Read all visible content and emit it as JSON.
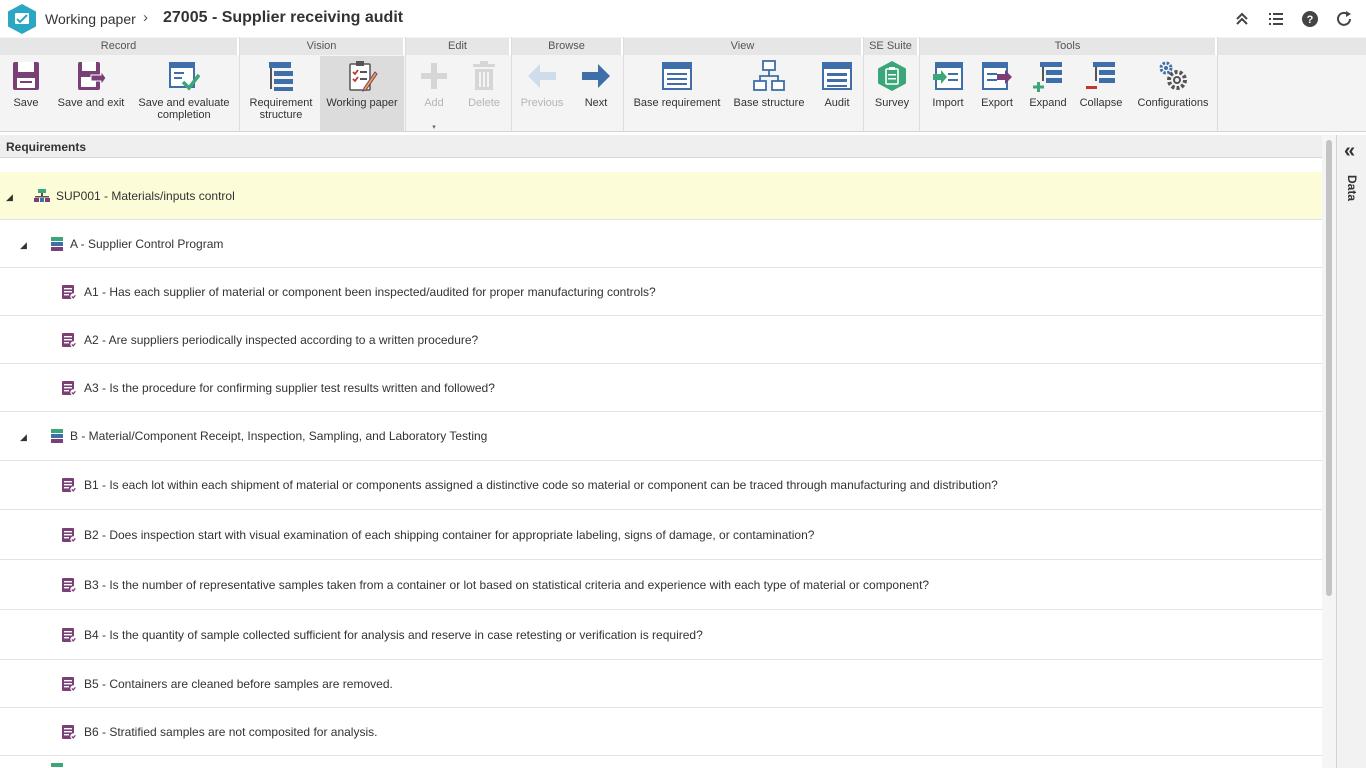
{
  "titlebar": {
    "app_name": "Working paper",
    "separator": "›",
    "title": "27005 - Supplier receiving audit",
    "icons": [
      "collapse-up-icon",
      "list-icon",
      "help-icon",
      "refresh-icon"
    ]
  },
  "ribbon": {
    "groups": {
      "record": "Record",
      "vision": "Vision",
      "edit": "Edit",
      "browse": "Browse",
      "view": "View",
      "se_suite": "SE Suite",
      "tools": "Tools"
    },
    "buttons": {
      "save": "Save",
      "save_exit": "Save and exit",
      "save_evaluate": "Save and evaluate completion",
      "req_structure": "Requirement structure",
      "working_paper": "Working paper",
      "add": "Add",
      "delete": "Delete",
      "previous": "Previous",
      "next": "Next",
      "base_requirement": "Base requirement",
      "base_structure": "Base structure",
      "audit": "Audit",
      "survey": "Survey",
      "import": "Import",
      "export": "Export",
      "expand": "Expand",
      "collapse": "Collapse",
      "configurations": "Configurations"
    },
    "caret": "▾"
  },
  "panel": {
    "header": "Requirements",
    "rows": [
      {
        "text": "SUP001 - Materials/inputs control",
        "kind": "root",
        "toggle": "◢"
      },
      {
        "text": "A - Supplier Control Program",
        "kind": "section",
        "toggle": "◢"
      },
      {
        "text": "A1 - Has each supplier of material or component been inspected/audited for proper manufacturing controls?",
        "kind": "item"
      },
      {
        "text": "A2 - Are suppliers periodically inspected according to a written procedure?",
        "kind": "item"
      },
      {
        "text": "A3 - Is the procedure for confirming supplier test results written and followed?",
        "kind": "item"
      },
      {
        "text": "B - Material/Component Receipt, Inspection, Sampling, and Laboratory Testing",
        "kind": "section",
        "toggle": "◢"
      },
      {
        "text": "B1 - Is each lot within each shipment of material or components assigned a distinctive code so material or component can be traced through manufacturing and distribution?",
        "kind": "item"
      },
      {
        "text": "B2 - Does inspection start with visual examination of each shipping container for appropriate labeling, signs of damage, or contamination?",
        "kind": "item"
      },
      {
        "text": "B3 - Is the number of representative samples taken from a container or lot based on statistical criteria and experience with each type of material or component?",
        "kind": "item"
      },
      {
        "text": "B4 - Is the quantity of sample collected sufficient for analysis and reserve in case retesting or verification is required?",
        "kind": "item"
      },
      {
        "text": "B5 - Containers are cleaned before samples are removed.",
        "kind": "item"
      },
      {
        "text": "B6 - Stratified samples are not composited for analysis.",
        "kind": "item"
      }
    ]
  },
  "side_panel": {
    "label": "Data",
    "collapse_glyph": "«"
  },
  "colors": {
    "accent_teal": "#2ba7c4",
    "purple": "#7b3f77",
    "blue": "#3e6fa8",
    "green": "#3aa67a",
    "selected_row": "#fcfcd8"
  }
}
